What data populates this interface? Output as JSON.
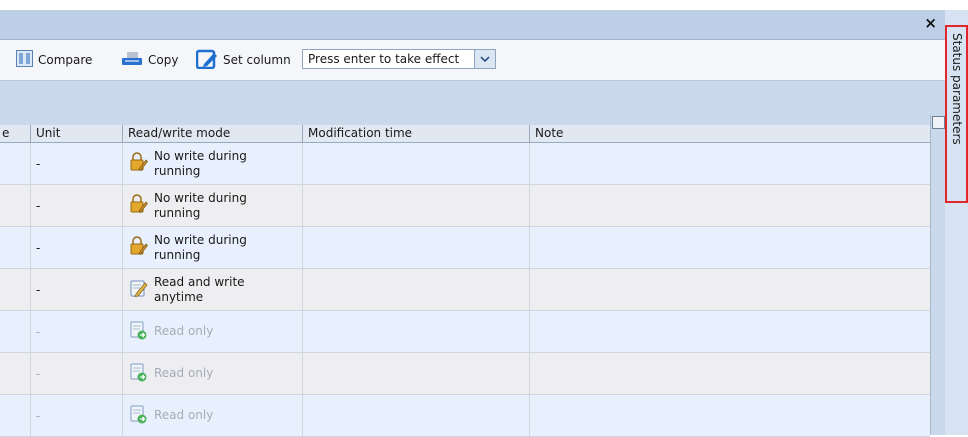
{
  "panel": {
    "close_glyph": "×"
  },
  "toolbar": {
    "compare_label": "Compare",
    "copy_label": "Copy",
    "set_column_label": "Set column",
    "filter_value": "Press enter to take effect"
  },
  "grid": {
    "columns": [
      "e",
      "Unit",
      "Read/write mode",
      "Modification time",
      "Note"
    ],
    "rows": [
      {
        "unit": "-",
        "mode_line1": "No write during",
        "mode_line2": "running",
        "mode_icon": "lock-pencil-icon"
      },
      {
        "unit": "-",
        "mode_line1": "No write during",
        "mode_line2": "running",
        "mode_icon": "lock-pencil-icon"
      },
      {
        "unit": "-",
        "mode_line1": "No write during",
        "mode_line2": "running",
        "mode_icon": "lock-pencil-icon"
      },
      {
        "unit": "-",
        "mode_line1": "Read and write",
        "mode_line2": "anytime",
        "mode_icon": "pencil-note-icon"
      },
      {
        "unit": "-",
        "mode_line1": "Read only",
        "mode_line2": "",
        "mode_icon": "read-only-doc-icon"
      },
      {
        "unit": "-",
        "mode_line1": "Read only",
        "mode_line2": "",
        "mode_icon": "read-only-doc-icon"
      },
      {
        "unit": "-",
        "mode_line1": "Read only",
        "mode_line2": "",
        "mode_icon": "read-only-doc-icon"
      }
    ]
  },
  "side_tab": {
    "label": "Status parameters"
  },
  "colors": {
    "row_even": "#e7f0fc",
    "row_odd": "#eeeef1",
    "highlight_border": "#e0282c",
    "accent_blue": "#1e6fd0"
  }
}
